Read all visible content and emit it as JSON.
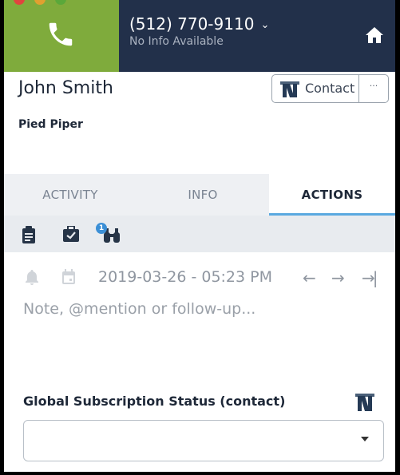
{
  "header": {
    "phone_number": "(512) 770-9110",
    "chevron": "⌄",
    "sub_text": "No Info Available",
    "icons": [
      "phone-icon",
      "home-icon",
      "chevron-down-icon"
    ],
    "colors": {
      "call_green": "#7fab3c",
      "nav_dark": "#22304a"
    }
  },
  "contact": {
    "name": "John Smith",
    "company": "Pied Piper",
    "contact_button_label": "Contact",
    "more_button_label": "···"
  },
  "tabs": [
    {
      "label": "ACTIVITY"
    },
    {
      "label": "INFO"
    },
    {
      "label": "ACTIONS"
    }
  ],
  "toolbar": {
    "icons": [
      "clipboard-icon",
      "briefcase-check-icon",
      "binoculars-icon"
    ],
    "badge_count": "1"
  },
  "activity": {
    "datetime": "2019-03-26 - 05:23 PM",
    "arrow_left": "←",
    "arrow_right": "→",
    "arrow_end": "→|",
    "note_placeholder": "Note, @mention or follow-up..."
  },
  "subscription": {
    "label": "Global Subscription Status (contact)",
    "selected_value": ""
  }
}
